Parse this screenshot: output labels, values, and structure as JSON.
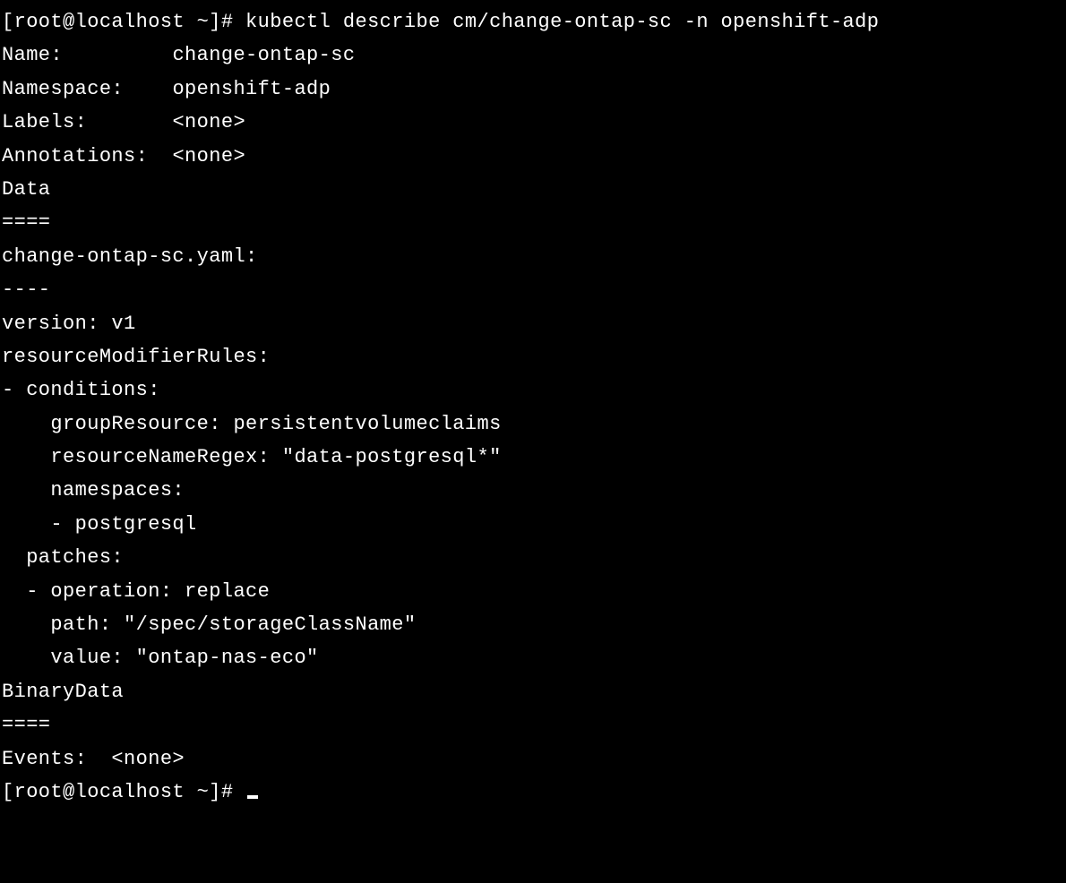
{
  "terminal": {
    "prompt1": "[root@localhost ~]# ",
    "command": "kubectl describe cm/change-ontap-sc -n openshift-adp",
    "output": {
      "name_label": "Name:         ",
      "name_value": "change-ontap-sc",
      "namespace_label": "Namespace:    ",
      "namespace_value": "openshift-adp",
      "labels_label": "Labels:       ",
      "labels_value": "<none>",
      "annotations_label": "Annotations:  ",
      "annotations_value": "<none>",
      "blank1": "",
      "data_header": "Data",
      "data_underline": "====",
      "data_key": "change-ontap-sc.yaml:",
      "data_dashes": "----",
      "yaml_version": "version: v1",
      "yaml_rules": "resourceModifierRules:",
      "yaml_conditions": "- conditions:",
      "yaml_group": "    groupResource: persistentvolumeclaims",
      "yaml_regex": "    resourceNameRegex: \"data-postgresql*\"",
      "yaml_namespaces": "    namespaces:",
      "yaml_ns_item": "    - postgresql",
      "yaml_patches": "  patches:",
      "yaml_operation": "  - operation: replace",
      "yaml_path": "    path: \"/spec/storageClassName\"",
      "yaml_value": "    value: \"ontap-nas-eco\"",
      "blank2": "",
      "binary_header": "BinaryData",
      "binary_underline": "====",
      "blank3": "",
      "events_label": "Events:  ",
      "events_value": "<none>"
    },
    "prompt2": "[root@localhost ~]# "
  }
}
